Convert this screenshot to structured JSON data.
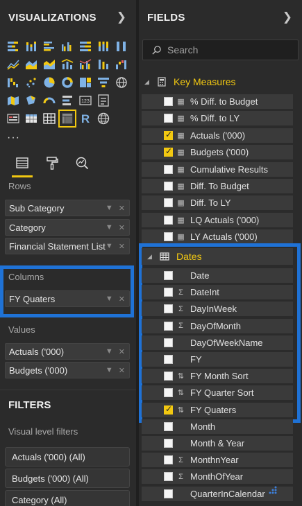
{
  "left_pane": {
    "title": "VISUALIZATIONS",
    "more": "···",
    "rows_label": "Rows",
    "rows": [
      "Sub Category",
      "Category",
      "Financial Statement List"
    ],
    "columns_label": "Columns",
    "columns": [
      "FY Quaters"
    ],
    "values_label": "Values",
    "values": [
      "Actuals ('000)",
      "Budgets ('000)"
    ],
    "filters_title": "FILTERS",
    "visual_level_filters_label": "Visual level filters",
    "filters": [
      "Actuals ('000) (All)",
      "Budgets ('000) (All)",
      "Category (All)"
    ]
  },
  "right_pane": {
    "title": "FIELDS",
    "search_placeholder": "Search",
    "groups": {
      "key_measures": {
        "name": "Key Measures",
        "fields": [
          {
            "name": "% Diff. to Budget",
            "checked": false,
            "icon": "calculator-icon"
          },
          {
            "name": "% Diff. to LY",
            "checked": false,
            "icon": "calculator-icon"
          },
          {
            "name": "Actuals ('000)",
            "checked": true,
            "icon": "calculator-icon"
          },
          {
            "name": "Budgets ('000)",
            "checked": true,
            "icon": "calculator-icon"
          },
          {
            "name": "Cumulative Results",
            "checked": false,
            "icon": "calculator-icon"
          },
          {
            "name": "Diff. To Budget",
            "checked": false,
            "icon": "calculator-icon"
          },
          {
            "name": "Diff. To LY",
            "checked": false,
            "icon": "calculator-icon"
          },
          {
            "name": "LQ Actuals ('000)",
            "checked": false,
            "icon": "calculator-icon"
          },
          {
            "name": "LY Actuals ('000)",
            "checked": false,
            "icon": "calculator-icon"
          }
        ]
      },
      "dates": {
        "name": "Dates",
        "fields": [
          {
            "name": "Date",
            "checked": false,
            "icon": ""
          },
          {
            "name": "DateInt",
            "checked": false,
            "icon": "sigma-icon"
          },
          {
            "name": "DayInWeek",
            "checked": false,
            "icon": "sigma-icon"
          },
          {
            "name": "DayOfMonth",
            "checked": false,
            "icon": "sigma-icon"
          },
          {
            "name": "DayOfWeekName",
            "checked": false,
            "icon": ""
          },
          {
            "name": "FY",
            "checked": false,
            "icon": ""
          },
          {
            "name": "FY Month Sort",
            "checked": false,
            "icon": "sort-icon"
          },
          {
            "name": "FY Quarter Sort",
            "checked": false,
            "icon": "sort-icon"
          },
          {
            "name": "FY Quaters",
            "checked": true,
            "icon": "sort-icon"
          },
          {
            "name": "Month",
            "checked": false,
            "icon": ""
          },
          {
            "name": "Month & Year",
            "checked": false,
            "icon": ""
          },
          {
            "name": "MonthnYear",
            "checked": false,
            "icon": "sigma-icon"
          },
          {
            "name": "MonthOfYear",
            "checked": false,
            "icon": "sigma-icon"
          },
          {
            "name": "QuarterInCalendar",
            "checked": false,
            "icon": ""
          }
        ]
      }
    }
  },
  "colors": {
    "accent_yellow": "#f2c811",
    "highlight_blue": "#1f72d6",
    "pane_bg": "#2b2b2b",
    "field_bg": "#3a3a3a"
  }
}
